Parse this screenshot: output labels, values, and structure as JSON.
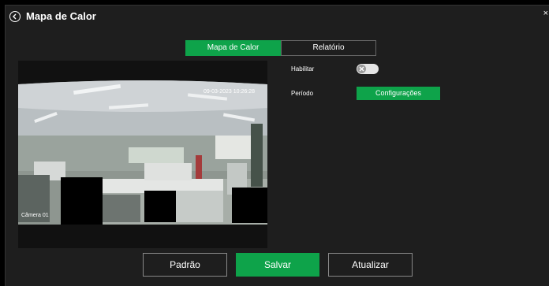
{
  "header": {
    "title": "Mapa de Calor",
    "close_label": "×"
  },
  "tabs": [
    {
      "label": "Mapa de Calor",
      "active": true
    },
    {
      "label": "Relatório",
      "active": false
    }
  ],
  "form": {
    "enable_label": "Habilitar",
    "enable_value": false,
    "period_label": "Período",
    "config_button": "Configurações"
  },
  "camera": {
    "overlay_timestamp": "09-03-2023 10:26:28",
    "overlay_channel": "Câmera 01"
  },
  "footer": {
    "default_button": "Padrão",
    "save_button": "Salvar",
    "refresh_button": "Atualizar"
  },
  "colors": {
    "accent": "#0ea34a",
    "panel_bg": "#1e1e1e"
  }
}
